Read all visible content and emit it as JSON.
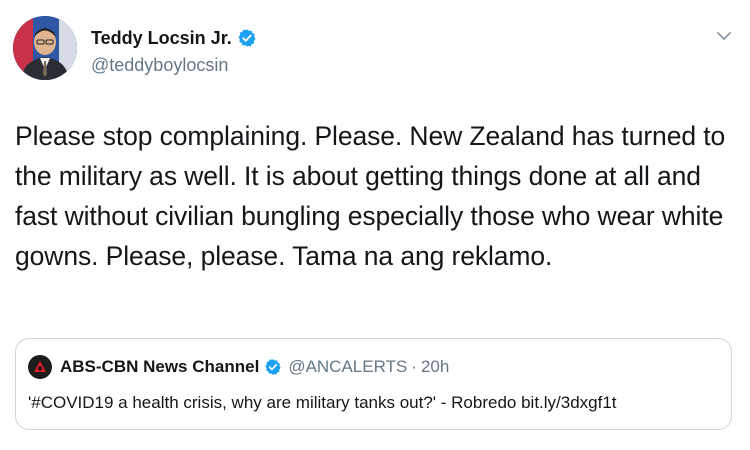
{
  "tweet": {
    "author": {
      "name": "Teddy Locsin Jr.",
      "handle": "@teddyboylocsin",
      "verified": true
    },
    "text": "Please stop complaining. Please. New Zealand has turned to the military as well. It is about getting things done at all and fast without civilian bungling especially those who wear white gowns. Please, please. Tama na ang reklamo.",
    "menu_icon": "chevron-down-icon"
  },
  "quoted_tweet": {
    "author_name": "ABS-CBN News Channel",
    "verified": true,
    "handle": "@ANCALERTS",
    "separator": "·",
    "time": "20h",
    "text": "'#COVID19 a health crisis, why are military tanks out?' - Robredo bit.ly/3dxgf1t"
  },
  "colors": {
    "verified_blue": "#1da1f2",
    "secondary_text": "#657786",
    "border": "#ccd6dd"
  }
}
